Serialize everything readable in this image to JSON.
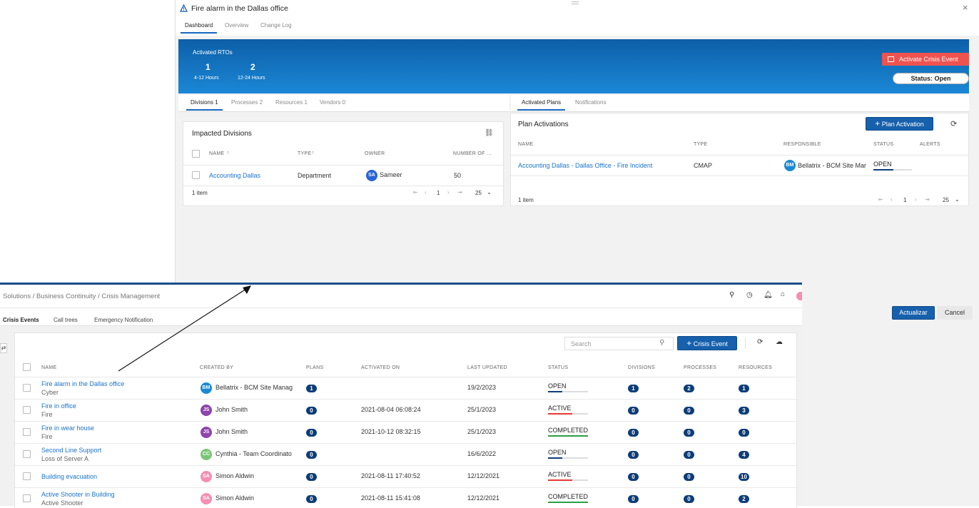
{
  "modal": {
    "title": "Fire alarm in the Dallas office",
    "tabs": [
      "Dashboard",
      "Overview",
      "Change Log"
    ],
    "close_icon": "×",
    "banner": {
      "label": "Activated RTOs",
      "rto": [
        {
          "value": "1",
          "label": "4-12 Hours"
        },
        {
          "value": "2",
          "label": "12-24 Hours"
        }
      ],
      "activate_button": "Activate Crisis Event",
      "status_button": "Status: Open"
    },
    "left_tabs": [
      "Divisions 1",
      "Processes 2",
      "Resources 1",
      "Vendors 0"
    ],
    "right_tabs": [
      "Activated Plans",
      "Notifications"
    ],
    "impacted": {
      "title": "Impacted Divisions",
      "headers": [
        "NAME",
        "TYPE",
        "OWNER",
        "NUMBER OF ..."
      ],
      "row": {
        "name": "Accounting Dallas",
        "type": "Department",
        "owner_initials": "SA",
        "owner": "Sameer",
        "number": "50"
      },
      "footer_items": "1 item",
      "page": "1",
      "page_size": "25"
    },
    "plans": {
      "title": "Plan Activations",
      "add_button": "Plan Activation",
      "headers": [
        "NAME",
        "TYPE",
        "RESPONSIBLE",
        "STATUS",
        "ALERTS"
      ],
      "row": {
        "name": "Accounting Dallas - Dallas Office - Fire Incident",
        "type": "CMAP",
        "resp_initials": "BM",
        "responsible": "Bellatrix - BCM Site Mar",
        "status": "OPEN"
      },
      "footer_items": "1 item",
      "page": "1",
      "page_size": "25"
    },
    "update_button": "Actualizar",
    "cancel_button": "Cancel"
  },
  "main": {
    "breadcrumb": "Solutions / Business Continuity / Crisis Management",
    "tabs": [
      "Crisis Events",
      "Call trees",
      "Emergency Notification"
    ],
    "search_placeholder": "Search",
    "add_button": "Crisis Event",
    "headers": [
      "NAME",
      "CREATED BY",
      "PLANS",
      "ACTIVATED ON",
      "LAST UPDATED",
      "STATUS",
      "DIVISIONS",
      "PROCESSES",
      "RESOURCES"
    ],
    "rows": [
      {
        "name": "Fire alarm in the Dallas office",
        "sub": "Cyber",
        "initials": "BM",
        "creator": "Bellatrix - BCM Site Manag",
        "plans": "1",
        "activated": "",
        "updated": "19/2/2023",
        "status": "OPEN",
        "divisions": "1",
        "processes": "2",
        "resources": "1"
      },
      {
        "name": "Fire in office",
        "sub": "Fire",
        "initials": "JS",
        "creator": "John Smith",
        "plans": "0",
        "activated": "2021-08-04 06:08:24",
        "updated": "25/1/2023",
        "status": "ACTIVE",
        "divisions": "0",
        "processes": "0",
        "resources": "3"
      },
      {
        "name": "Fire in wear house",
        "sub": "Fire",
        "initials": "JS",
        "creator": "John Smith",
        "plans": "0",
        "activated": "2021-10-12 08:32:15",
        "updated": "25/1/2023",
        "status": "COMPLETED",
        "divisions": "0",
        "processes": "0",
        "resources": "0"
      },
      {
        "name": "Second Line Support",
        "sub": "Loss of Server A",
        "initials": "CC",
        "creator": "Cynthia - Team Coordinato",
        "plans": "0",
        "activated": "",
        "updated": "16/6/2022",
        "status": "OPEN",
        "divisions": "0",
        "processes": "0",
        "resources": "4"
      },
      {
        "name": "Building evacuation",
        "sub": "",
        "initials": "SA",
        "creator": "Simon Aldwin",
        "plans": "0",
        "activated": "2021-08-11 17:40:52",
        "updated": "12/12/2021",
        "status": "ACTIVE",
        "divisions": "0",
        "processes": "0",
        "resources": "10"
      },
      {
        "name": "Active Shooter in Building",
        "sub": "Active Shooter",
        "initials": "SA",
        "creator": "Simon Aldwin",
        "plans": "0",
        "activated": "2021-08-11 15:41:08",
        "updated": "12/12/2021",
        "status": "COMPLETED",
        "divisions": "0",
        "processes": "0",
        "resources": "2"
      }
    ]
  },
  "colors": {
    "brand": "#1660ac",
    "open": "#0d3d78",
    "active": "#e53935",
    "completed": "#2e9e44",
    "danger": "#ef5350"
  }
}
